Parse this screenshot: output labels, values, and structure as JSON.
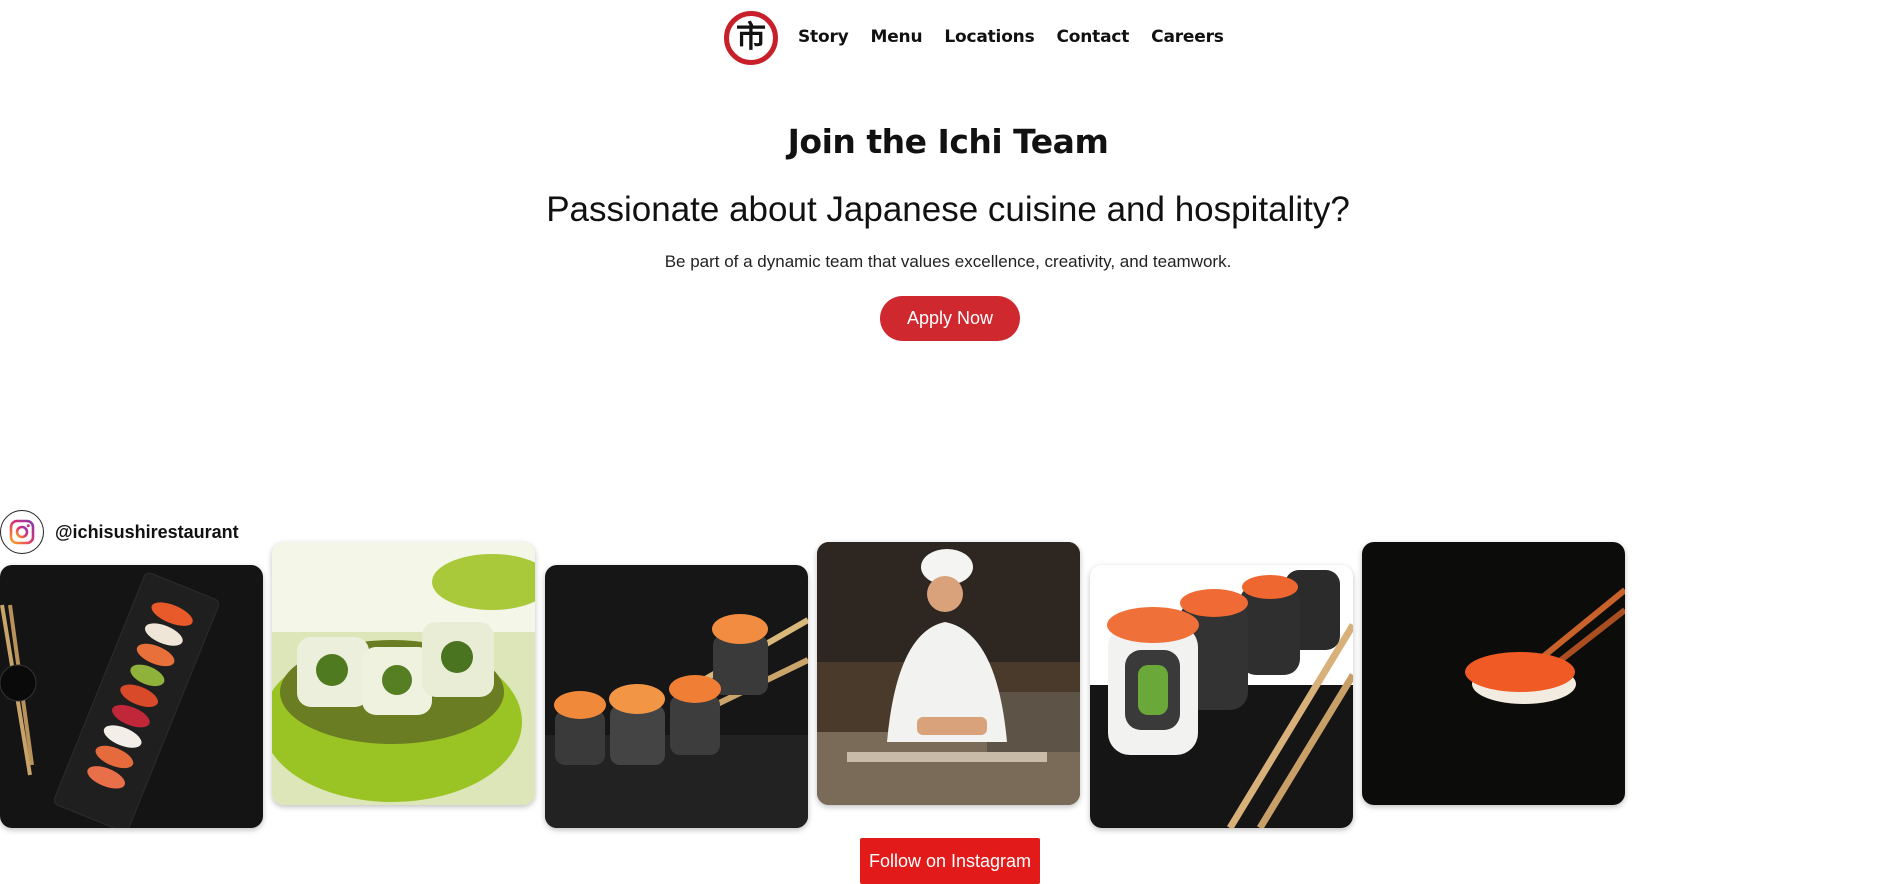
{
  "nav": {
    "logo_glyph": "市",
    "links": [
      "Story",
      "Menu",
      "Locations",
      "Contact",
      "Careers"
    ]
  },
  "hero": {
    "title": "Join the Ichi Team",
    "subtitle": "Passionate about Japanese cuisine and hospitality?",
    "text": "Be part of a dynamic team that values excellence, creativity, and teamwork.",
    "cta_label": "Apply Now"
  },
  "instagram": {
    "icon": "instagram-icon",
    "handle": "@ichisushirestaurant",
    "follow_label": "Follow on Instagram",
    "photos": [
      "sushi-platter-photo",
      "green-roll-bowl-photo",
      "topped-rolls-chopsticks-photo",
      "sushi-chef-photo",
      "salmon-roe-rolls-photo",
      "nigiri-chopsticks-photo"
    ]
  },
  "colors": {
    "brand_red": "#d0282f",
    "follow_red": "#e21a1a",
    "text": "#111111"
  }
}
